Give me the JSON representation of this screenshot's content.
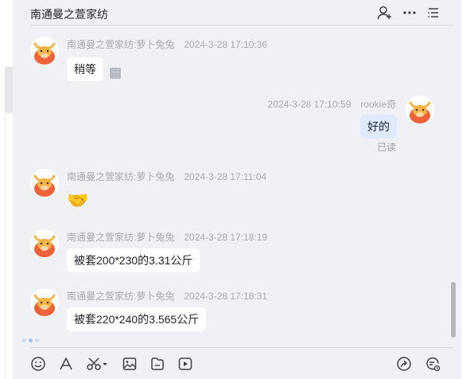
{
  "header": {
    "title": "南通曼之萱家纺",
    "icons": [
      "add-member-icon",
      "more-icon",
      "list-icon"
    ]
  },
  "messages": [
    {
      "sender": "南通曼之萱家纺:萝卜兔兔",
      "time": "2024-3-28 17:10:36",
      "text": "稍等",
      "side": "left",
      "badge": "···"
    },
    {
      "sender": "rookie奇",
      "time": "2024-3-28 17:10:59",
      "text": "好的",
      "side": "right",
      "status": "已读"
    },
    {
      "sender": "南通曼之萱家纺:萝卜兔兔",
      "time": "2024-3-28 17:11:04",
      "text": "🤝",
      "side": "left"
    },
    {
      "sender": "南通曼之萱家纺:萝卜兔兔",
      "time": "2024-3-28 17:18:19",
      "text": "被套200*230的3.31公斤",
      "side": "left"
    },
    {
      "sender": "南通曼之萱家纺:萝卜兔兔",
      "time": "2024-3-28 17:18:31",
      "text": "被套220*240的3.565公斤",
      "side": "left"
    }
  ],
  "toolbar": {
    "icons": [
      "emoji-icon",
      "font-icon",
      "screenshot-icon",
      "image-icon",
      "file-icon",
      "video-icon",
      "share-icon",
      "history-icon"
    ]
  },
  "colors": {
    "panel_bg": "#f0f1f5",
    "mine_bubble": "#dfe9ff",
    "meta_text": "#a7abb2"
  }
}
